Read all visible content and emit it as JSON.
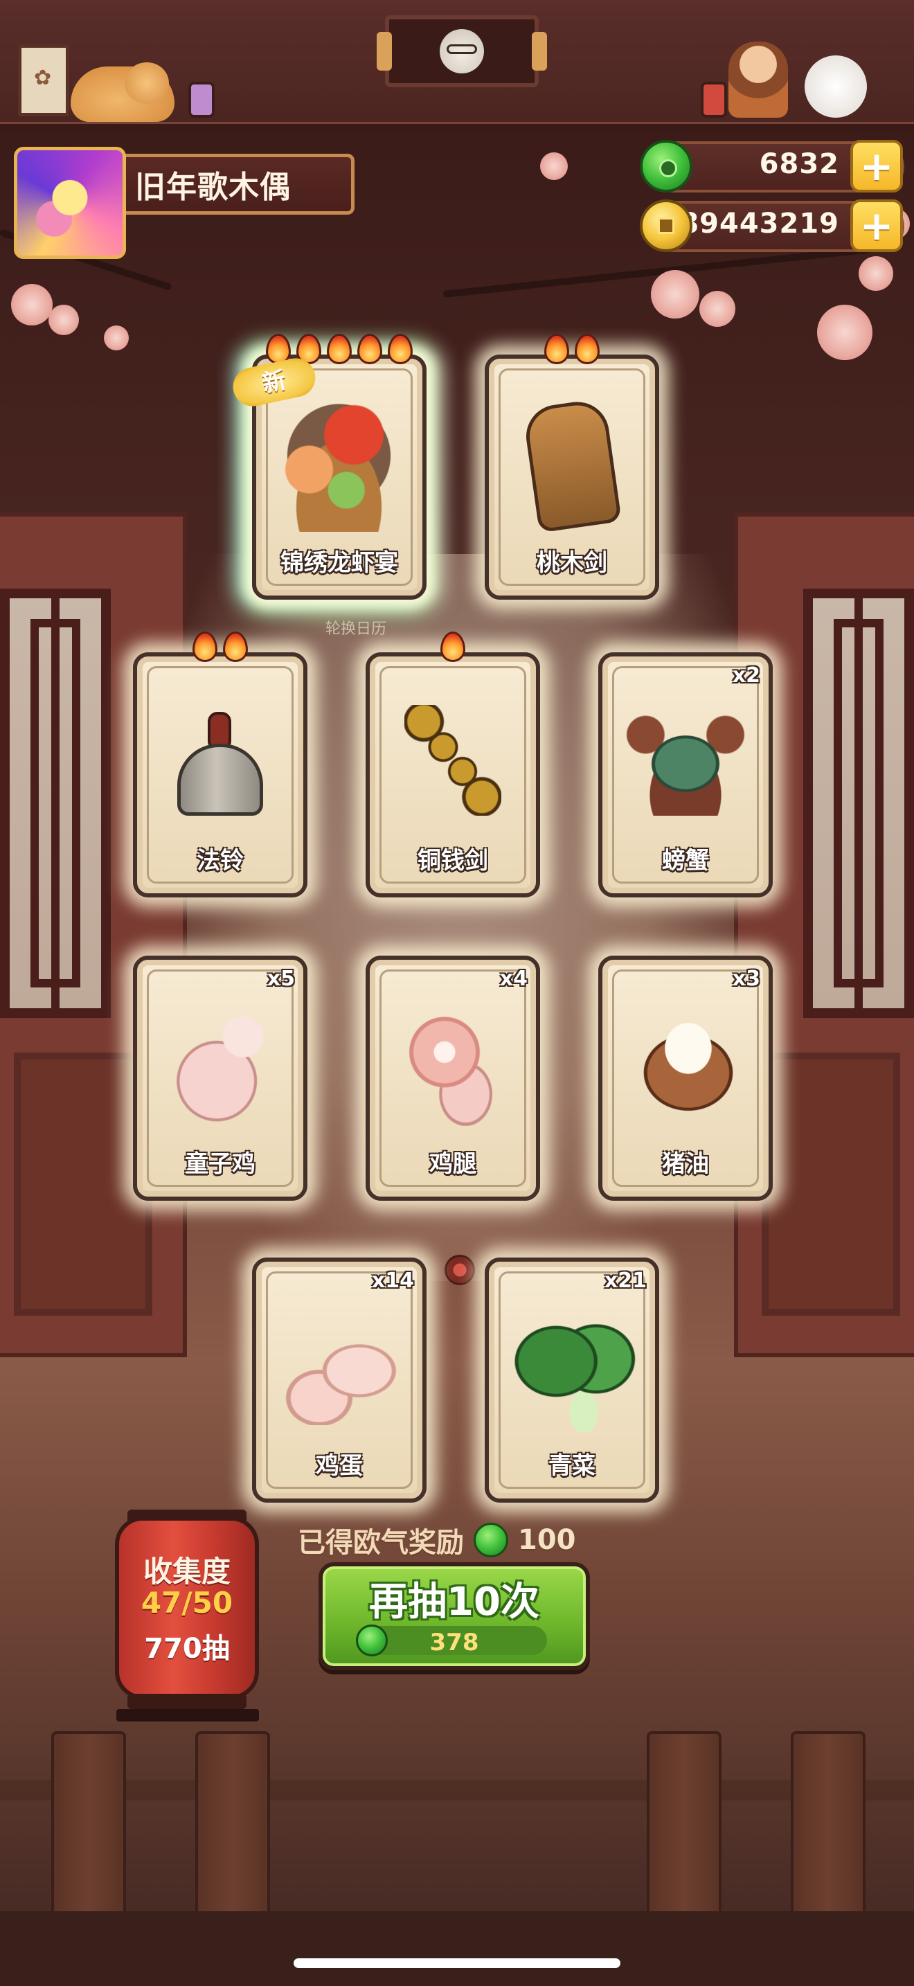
{
  "player": {
    "name": "旧年歌木偶",
    "avatar_icon": "player-avatar"
  },
  "currency": {
    "jade": "6832",
    "coins": "89443219",
    "plus": "+"
  },
  "background": {
    "hall_label": "轮换日历"
  },
  "cards": [
    {
      "name": "锦绣龙虾宴",
      "count": "",
      "flames": 5,
      "badge": "新",
      "rainbow": true,
      "art": "feast-icon"
    },
    {
      "name": "桃木剑",
      "count": "",
      "flames": 2,
      "badge": "",
      "rainbow": false,
      "art": "wooden-sword-icon"
    },
    {
      "name": "法铃",
      "count": "",
      "flames": 2,
      "badge": "",
      "rainbow": false,
      "art": "bell-icon"
    },
    {
      "name": "铜钱剑",
      "count": "",
      "flames": 1,
      "badge": "",
      "rainbow": false,
      "art": "coin-sword-icon"
    },
    {
      "name": "螃蟹",
      "count": "x2",
      "flames": 0,
      "badge": "",
      "rainbow": false,
      "art": "crab-icon"
    },
    {
      "name": "童子鸡",
      "count": "x5",
      "flames": 0,
      "badge": "",
      "rainbow": false,
      "art": "chicken-icon"
    },
    {
      "name": "鸡腿",
      "count": "x4",
      "flames": 0,
      "badge": "",
      "rainbow": false,
      "art": "drumstick-icon"
    },
    {
      "name": "猪油",
      "count": "x3",
      "flames": 0,
      "badge": "",
      "rainbow": false,
      "art": "lard-icon"
    },
    {
      "name": "鸡蛋",
      "count": "x14",
      "flames": 0,
      "badge": "",
      "rainbow": false,
      "art": "egg-icon"
    },
    {
      "name": "青菜",
      "count": "x21",
      "flames": 0,
      "badge": "",
      "rainbow": false,
      "art": "greens-icon"
    }
  ],
  "reward": {
    "label": "已得欧气奖励",
    "value": "100"
  },
  "draw_button": {
    "label": "再抽10次",
    "cost": "378"
  },
  "collection": {
    "title": "收集度",
    "progress": "47/50",
    "draws": "770抽"
  },
  "colors": {
    "accent_green": "#6cb52a",
    "card_bg": "#f2e4c8",
    "lantern_red": "#e34f3e",
    "gold": "#f5c53a"
  }
}
